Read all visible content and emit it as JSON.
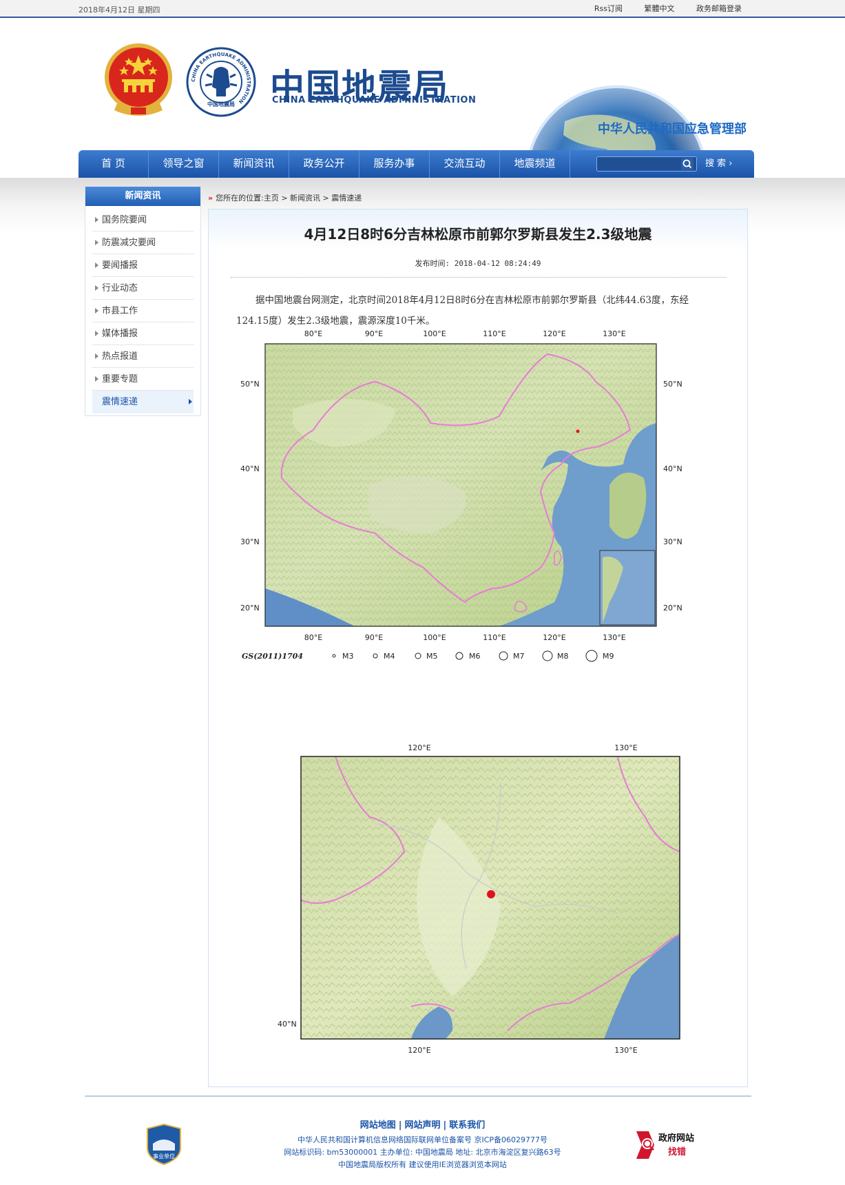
{
  "topbar": {
    "date": "2018年4月12日  星期四",
    "links": [
      "Rss订阅",
      "繁體中文",
      "政务邮箱登录"
    ]
  },
  "header": {
    "brand_cn": "中国地震局",
    "brand_en": "CHINA EARTHQUAKE ADMINISTRATION",
    "logo_ring_text": "CHINA EARTHQUAKE ADMINISTRATION",
    "logo_inner_text": "中国地震局",
    "dept": "中华人民共和国应急管理部"
  },
  "nav": {
    "items": [
      "首  页",
      "领导之窗",
      "新闻资讯",
      "政务公开",
      "服务办事",
      "交流互动",
      "地震频道"
    ],
    "search_placeholder": "",
    "search_label": "搜  索 ›"
  },
  "sidebar": {
    "title": "新闻资讯",
    "items": [
      "国务院要闻",
      "防震减灾要闻",
      "要闻播报",
      "行业动态",
      "市县工作",
      "媒体播报",
      "热点报道",
      "重要专题",
      "震情速递"
    ],
    "active_index": 8
  },
  "breadcrumb": {
    "marker": "»",
    "prefix": "您所在的位置:",
    "path": [
      "主页",
      "新闻资讯",
      "震情速递"
    ],
    "sep": " > "
  },
  "article": {
    "title": "4月12日8时6分吉林松原市前郭尔罗斯县发生2.3级地震",
    "pubtime": "发布时间: 2018-04-12 08:24:49",
    "body": "据中国地震台网测定，北京时间2018年4月12日8时6分在吉林松原市前郭尔罗斯县（北纬44.63度，东经124.15度）发生2.3级地震，震源深度10千米。"
  },
  "map_overview": {
    "lon_labels": [
      "80°E",
      "90°E",
      "100°E",
      "110°E",
      "120°E",
      "130°E"
    ],
    "lat_labels": [
      "50°N",
      "40°N",
      "30°N",
      "20°N"
    ],
    "map_code": "GS(2011)1704",
    "magnitude_legend": [
      "M3",
      "M4",
      "M5",
      "M6",
      "M7",
      "M8",
      "M9"
    ],
    "epicenter": {
      "lon": 124.15,
      "lat": 44.63
    }
  },
  "map_detail": {
    "lon_labels": [
      "120°E",
      "130°E"
    ],
    "lat_labels": [
      "40°N"
    ],
    "epicenter": {
      "lon": 124.15,
      "lat": 44.63
    }
  },
  "footer": {
    "links": [
      "网站地图",
      "网站声明",
      "联系我们"
    ],
    "lines": [
      "中华人民共和国计算机信息网络国际联网单位备案号  京ICP备06029777号",
      "网站标识码: bm53000001  主办单位: 中国地震局  地址: 北京市海淀区复兴路63号",
      "中国地震局版权所有  建议使用IE浏览器浏览本网站"
    ],
    "badge_left": "事业单位",
    "badge_right_top": "政府网站",
    "badge_right_bottom": "找错"
  },
  "colors": {
    "nav_blue": "#1a53a8",
    "brand_blue": "#1c4b8f",
    "epicenter_red": "#e0141e",
    "border_pink": "#e87bd6"
  }
}
